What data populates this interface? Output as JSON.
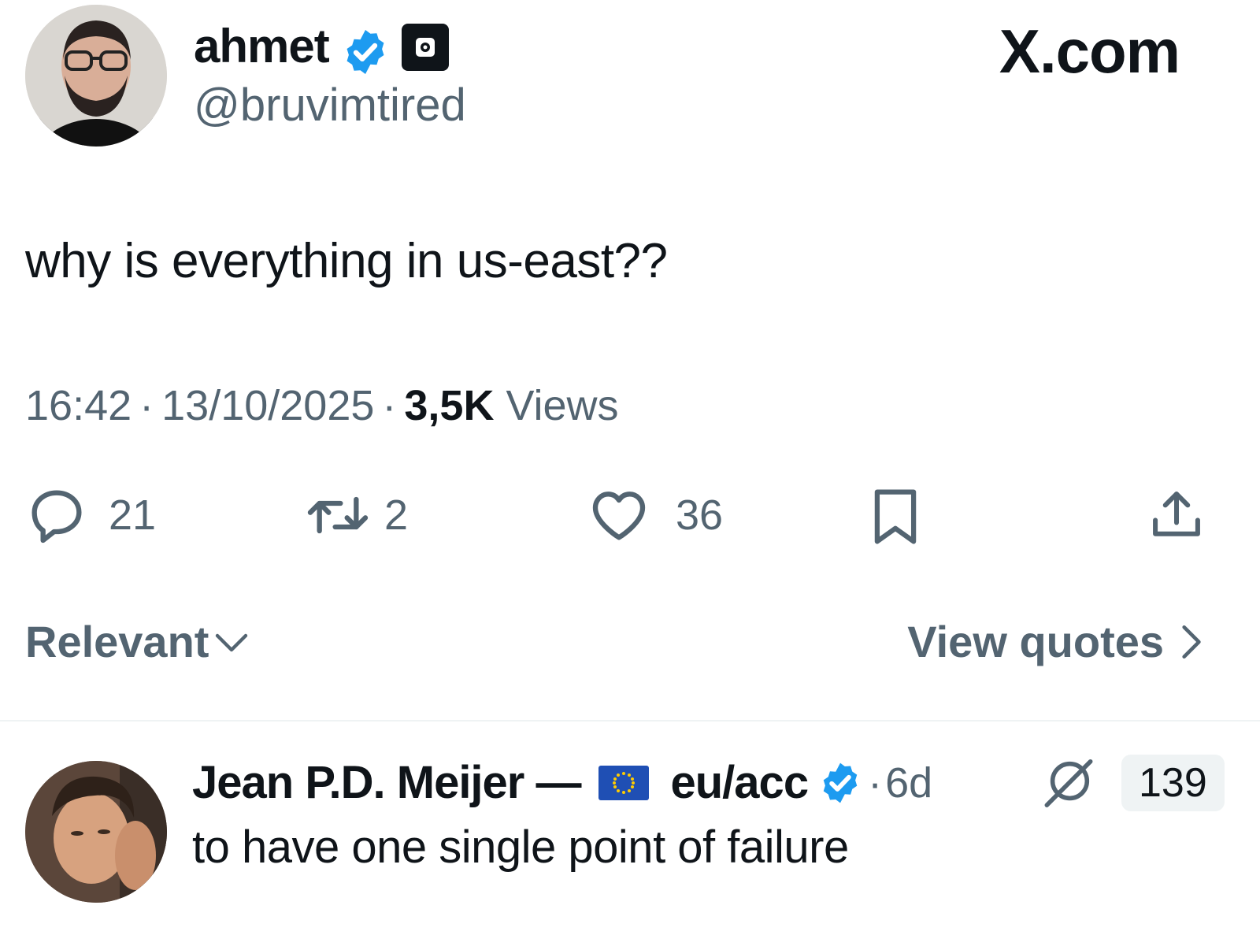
{
  "tweet": {
    "author_name": "ahmet",
    "handle": "@bruvimtired",
    "site_label": "X.com",
    "text": "why is everything in us-east??",
    "time": "16:42",
    "separator": "·",
    "date": "13/10/2025",
    "views_count": "3,5K",
    "views_label": "Views",
    "actions": {
      "reply_count": "21",
      "retweet_count": "2",
      "like_count": "36"
    },
    "accent_color": "#1d9bf0"
  },
  "replies_header": {
    "sort_label": "Relevant",
    "quotes_link": "View quotes"
  },
  "reply": {
    "author_name": "Jean P.D. Meijer —",
    "author_name_suffix": "eu/acc",
    "separator": "·",
    "time_ago": "6d",
    "count": "139",
    "text": "to have one single point of failure"
  },
  "icons": [
    "verified-badge-icon",
    "affiliate-badge-icon",
    "reply-icon",
    "retweet-icon",
    "like-icon",
    "bookmark-icon",
    "share-icon",
    "chevron-down-icon",
    "chevron-right-icon",
    "eu-flag-icon",
    "grok-icon"
  ]
}
